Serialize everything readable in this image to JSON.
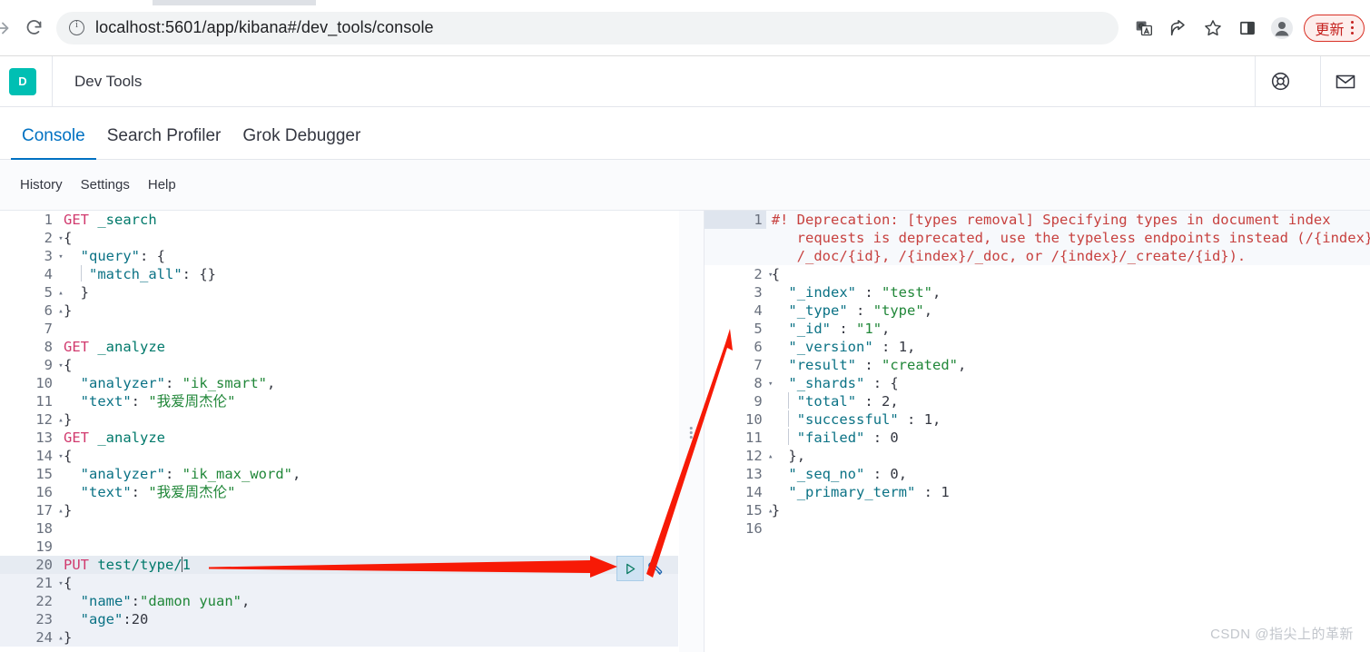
{
  "browser": {
    "url": "localhost:5601/app/kibana#/dev_tools/console",
    "forward_icon": "forward-arrow-icon",
    "reload_icon": "reload-icon",
    "site_info_icon": "site-info-icon",
    "toolbar_icons": [
      "translate-icon",
      "share-icon",
      "bookmark-star-icon",
      "side-panel-icon",
      "profile-avatar-icon"
    ],
    "update_button_label": "更新",
    "menu_icon": "kebab-menu-icon"
  },
  "app_header": {
    "logo_letter": "D",
    "logo_color": "#00BFB3",
    "title": "Dev Tools",
    "help_icon": "lifebuoy-help-icon",
    "mail_icon": "envelope-icon"
  },
  "tabs": [
    {
      "label": "Console",
      "active": true
    },
    {
      "label": "Search Profiler",
      "active": false
    },
    {
      "label": "Grok Debugger",
      "active": false
    }
  ],
  "submenu": [
    "History",
    "Settings",
    "Help"
  ],
  "colors": {
    "accent": "#0071c2",
    "brand": "#00BFB3",
    "method": "#d13a6e",
    "url": "#00796b",
    "key": "#0b7285",
    "string": "#218739",
    "warning": "#c7413f",
    "annotation_arrow": "#f71a06"
  },
  "request_editor": {
    "name": "console-request-editor",
    "active_line": 20,
    "lines": [
      {
        "n": 1,
        "fold": "",
        "html": "<span class='m-method'>GET</span> <span class='m-url'>_search</span>"
      },
      {
        "n": 2,
        "fold": "▾",
        "html": "<span class='j-punct'>{</span>"
      },
      {
        "n": 3,
        "fold": "▾",
        "html": "  <span class='j-key'>\"query\"</span><span class='j-punct'>: {</span>"
      },
      {
        "n": 4,
        "fold": "",
        "html": "  <span class='indent-guide'></span> <span class='j-key'>\"match_all\"</span><span class='j-punct'>: {}</span>"
      },
      {
        "n": 5,
        "fold": "▴",
        "html": "  <span class='j-punct'>}</span>"
      },
      {
        "n": 6,
        "fold": "▴",
        "html": "<span class='j-punct'>}</span>"
      },
      {
        "n": 7,
        "fold": "",
        "html": ""
      },
      {
        "n": 8,
        "fold": "",
        "html": "<span class='m-method'>GET</span> <span class='m-url'>_analyze</span>"
      },
      {
        "n": 9,
        "fold": "▾",
        "html": "<span class='j-punct'>{</span>"
      },
      {
        "n": 10,
        "fold": "",
        "html": "  <span class='j-key'>\"analyzer\"</span><span class='j-punct'>: </span><span class='j-str'>\"ik_smart\"</span><span class='j-punct'>,</span>"
      },
      {
        "n": 11,
        "fold": "",
        "html": "  <span class='j-key'>\"text\"</span><span class='j-punct'>: </span><span class='j-str'>\"我爱周杰伦\"</span>"
      },
      {
        "n": 12,
        "fold": "▴",
        "html": "<span class='j-punct'>}</span>"
      },
      {
        "n": 13,
        "fold": "",
        "html": "<span class='m-method'>GET</span> <span class='m-url'>_analyze</span>"
      },
      {
        "n": 14,
        "fold": "▾",
        "html": "<span class='j-punct'>{</span>"
      },
      {
        "n": 15,
        "fold": "",
        "html": "  <span class='j-key'>\"analyzer\"</span><span class='j-punct'>: </span><span class='j-str'>\"ik_max_word\"</span><span class='j-punct'>,</span>"
      },
      {
        "n": 16,
        "fold": "",
        "html": "  <span class='j-key'>\"text\"</span><span class='j-punct'>: </span><span class='j-str'>\"我爱周杰伦\"</span>"
      },
      {
        "n": 17,
        "fold": "▴",
        "html": "<span class='j-punct'>}</span>"
      },
      {
        "n": 18,
        "fold": "",
        "html": ""
      },
      {
        "n": 19,
        "fold": "",
        "html": ""
      },
      {
        "n": 20,
        "fold": "",
        "html": "<span class='m-method'>PUT</span> <span class='m-url'>test/type/</span><span class='cursor'></span><span class='m-url'>1</span>"
      },
      {
        "n": 21,
        "fold": "▾",
        "html": "<span class='j-punct'>{</span>"
      },
      {
        "n": 22,
        "fold": "",
        "html": "  <span class='j-key'>\"name\"</span><span class='j-punct'>:</span><span class='j-str'>\"damon yuan\"</span><span class='j-punct'>,</span>"
      },
      {
        "n": 23,
        "fold": "",
        "html": "  <span class='j-key'>\"age\"</span><span class='j-punct'>:</span><span class='j-num'>20</span>"
      },
      {
        "n": 24,
        "fold": "▴",
        "html": "<span class='j-punct'>}</span>"
      }
    ],
    "plain_text": [
      "GET _search",
      "{",
      "  \"query\": {",
      "    \"match_all\": {}",
      "  }",
      "}",
      "",
      "GET _analyze",
      "{",
      "  \"analyzer\": \"ik_smart\",",
      "  \"text\": \"我爱周杰伦\"",
      "}",
      "GET _analyze",
      "{",
      "  \"analyzer\": \"ik_max_word\",",
      "  \"text\": \"我爱周杰伦\"",
      "}",
      "",
      "",
      "PUT test/type/1",
      "{",
      "  \"name\":\"damon yuan\",",
      "  \"age\":20",
      "}"
    ]
  },
  "run_controls": {
    "play_button_title": "Click to send request",
    "play_icon": "play-triangle-icon",
    "wrench_icon": "wrench-icon"
  },
  "response_editor": {
    "name": "console-response-editor",
    "lines": [
      {
        "n": 1,
        "fold": "",
        "wrap": 3,
        "html": "<span class='warn'>#! Deprecation: [types removal] Specifying types in document index</span>"
      },
      {
        "n": "",
        "fold": "",
        "cont": true,
        "html": "<span class='warn'>   requests is deprecated, use the typeless endpoints instead (/{index}</span>"
      },
      {
        "n": "",
        "fold": "",
        "cont": true,
        "html": "<span class='warn'>   /_doc/{id}, /{index}/_doc, or /{index}/_create/{id}).</span>"
      },
      {
        "n": 2,
        "fold": "▾",
        "html": "<span class='j-punct'>{</span>"
      },
      {
        "n": 3,
        "fold": "",
        "html": "  <span class='j-key'>\"_index\"</span><span class='j-punct'> : </span><span class='j-str'>\"test\"</span><span class='j-punct'>,</span>"
      },
      {
        "n": 4,
        "fold": "",
        "html": "  <span class='j-key'>\"_type\"</span><span class='j-punct'> : </span><span class='j-str'>\"type\"</span><span class='j-punct'>,</span>"
      },
      {
        "n": 5,
        "fold": "",
        "html": "  <span class='j-key'>\"_id\"</span><span class='j-punct'> : </span><span class='j-str'>\"1\"</span><span class='j-punct'>,</span>"
      },
      {
        "n": 6,
        "fold": "",
        "html": "  <span class='j-key'>\"_version\"</span><span class='j-punct'> : </span><span class='j-num'>1</span><span class='j-punct'>,</span>"
      },
      {
        "n": 7,
        "fold": "",
        "html": "  <span class='j-key'>\"result\"</span><span class='j-punct'> : </span><span class='j-str'>\"created\"</span><span class='j-punct'>,</span>"
      },
      {
        "n": 8,
        "fold": "▾",
        "html": "  <span class='j-key'>\"_shards\"</span><span class='j-punct'> : {</span>"
      },
      {
        "n": 9,
        "fold": "",
        "html": "  <span class='indent-guide'></span> <span class='j-key'>\"total\"</span><span class='j-punct'> : </span><span class='j-num'>2</span><span class='j-punct'>,</span>"
      },
      {
        "n": 10,
        "fold": "",
        "html": "  <span class='indent-guide'></span> <span class='j-key'>\"successful\"</span><span class='j-punct'> : </span><span class='j-num'>1</span><span class='j-punct'>,</span>"
      },
      {
        "n": 11,
        "fold": "",
        "html": "  <span class='indent-guide'></span> <span class='j-key'>\"failed\"</span><span class='j-punct'> : </span><span class='j-num'>0</span>"
      },
      {
        "n": 12,
        "fold": "▴",
        "html": "  <span class='j-punct'>},</span>"
      },
      {
        "n": 13,
        "fold": "",
        "html": "  <span class='j-key'>\"_seq_no\"</span><span class='j-punct'> : </span><span class='j-num'>0</span><span class='j-punct'>,</span>"
      },
      {
        "n": 14,
        "fold": "",
        "html": "  <span class='j-key'>\"_primary_term\"</span><span class='j-punct'> : </span><span class='j-num'>1</span>"
      },
      {
        "n": 15,
        "fold": "▴",
        "html": "<span class='j-punct'>}</span>"
      },
      {
        "n": 16,
        "fold": "",
        "html": ""
      }
    ],
    "plain_text": [
      "#! Deprecation: [types removal] Specifying types in document index requests is deprecated, use the typeless endpoints instead (/{index}/_doc/{id}, /{index}/_doc, or /{index}/_create/{id}).",
      "{",
      "  \"_index\" : \"test\",",
      "  \"_type\" : \"type\",",
      "  \"_id\" : \"1\",",
      "  \"_version\" : 1,",
      "  \"result\" : \"created\",",
      "  \"_shards\" : {",
      "    \"total\" : 2,",
      "    \"successful\" : 1,",
      "    \"failed\" : 0",
      "  },",
      "  \"_seq_no\" : 0,",
      "  \"_primary_term\" : 1",
      "}",
      ""
    ]
  },
  "annotations": [
    {
      "name": "arrow-to-play-button",
      "type": "arrow-horizontal"
    },
    {
      "name": "arrow-to-response",
      "type": "arrow-diagonal"
    }
  ],
  "watermark": "CSDN @指尖上的革新"
}
